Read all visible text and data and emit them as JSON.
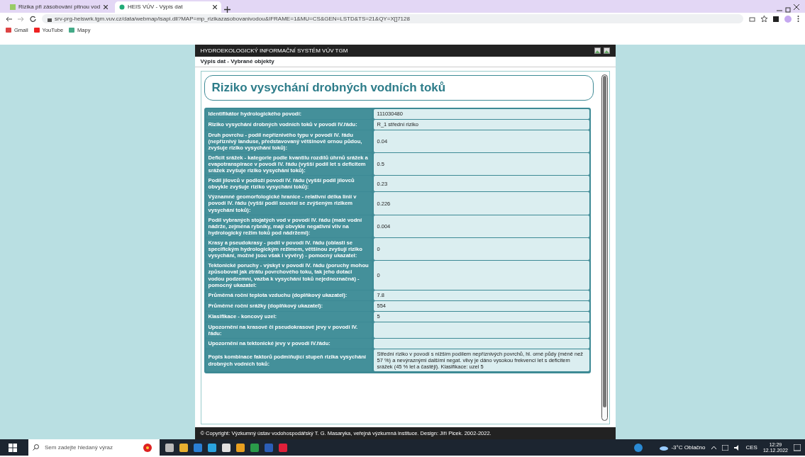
{
  "browser": {
    "tabs": [
      {
        "title": "Rizika při zásobování pitnou vod",
        "selected": false
      },
      {
        "title": "HEIS VÚV - Výpis dat",
        "selected": true
      }
    ],
    "url": "srv-prg-heiswrk.tgm.vuv.cz/data/webmap/isapi.dll?MAP=mp_rizikazasobovanivodou&IFRAME=1&MU=CS&GEN=LSTD&TS=21&QY=X[]7128",
    "bookmarks": [
      "Gmail",
      "YouTube",
      "Mapy"
    ]
  },
  "page": {
    "header": "HYDROEKOLOGICKÝ INFORMAČNÍ SYSTÉM VÚV TGM",
    "subheader": "Výpis dat - Vybrané objekty",
    "title": "Riziko vysychání drobných vodních toků",
    "rows": [
      {
        "label": "Identifikátor hydrologického povodí:",
        "value": "111030480"
      },
      {
        "label": "Riziko vysychání drobných vodních toků v povodí IV.řádu:",
        "value": "R_1 střední riziko"
      },
      {
        "label": "Druh povrchu - podíl nepříznivého typu v povodí IV. řádu (nepříznivý landuse, představovaný většinově ornou půdou, zvyšuje riziko vysychání toků):",
        "value": "0.04"
      },
      {
        "label": "Deficit srážek - kategorie podle kvantilu rozdílů úhrnů srážek a evapotranspirace v povodí IV. řádu (vyšší podíl let s deficitem srážek zvyšuje riziko vysychání toků):",
        "value": "0.5"
      },
      {
        "label": "Podíl jílovců v podloží povodí IV. řádu (vyšší podíl jílovců obvykle zvyšuje riziko vysychání toků):",
        "value": "0.23"
      },
      {
        "label": "Významné geomorfologické hranice - relativní délka linií v povodí IV. řádu (vyšší podíl souvisí se zvýšeným rizikem vysychání toků):",
        "value": "0.226"
      },
      {
        "label": "Podíl vybraných stojatých vod v povodí IV. řádu (malé vodní nádrže, zejména rybníky, mají obvykle negativní vliv na hydrologický režim toků pod nádržemi):",
        "value": "0.004"
      },
      {
        "label": "Krasy a pseudokrasy - podíl v povodí IV. řádu (oblasti se specifickým hydrologickým režimem, většinou zvyšují riziko vysychání, možné jsou však i vývěry) - pomocný ukazatel:",
        "value": "0"
      },
      {
        "label": "Tektonické poruchy - výskyt v povodí IV. řádu (poruchy mohou způsobovat jak ztrátu povrchového toku, tak jeho dotaci vodou podzemní, vazba k vysychání toků nejednoznačná) - pomocný ukazatel:",
        "value": "0"
      },
      {
        "label": "Průměrná roční teplota vzduchu (doplňkový ukazatel):",
        "value": "7.8"
      },
      {
        "label": "Průměrné roční srážky (doplňkový ukazatel):",
        "value": "554"
      },
      {
        "label": "Klasifikace - koncový uzel:",
        "value": "5"
      },
      {
        "label": "Upozornění na krasové či pseudokrasové jevy v povodí IV. řádu:"
      },
      {
        "label": "Upozornění na tektonické jevy v povodí IV.řádu:"
      },
      {
        "label": "Popis kombinace faktorů podmiňující stupeň rizika vysychání drobných vodních toků:",
        "value": "Střední riziko v povodí s nižším podílem nepříznivých povrchů, hl. orné půdy (méně než 57 %) a nevýraznými dalšími negat. vlivy je dáno vysokou frekvencí let s deficitem srážek (45 % let a častěji). Klasifikace: uzel 5"
      }
    ],
    "footer": "© Copyright: Výzkumný ústav vodohospodářský T. G. Masaryka, veřejná výzkumná instituce. Design: Jiří Picek. 2002-2022."
  },
  "taskbar": {
    "search_placeholder": "Sem zadejte hledaný výraz",
    "weather": "-3°C Oblačno",
    "language": "CES",
    "time": "12:29",
    "date": "12.12.2022"
  }
}
